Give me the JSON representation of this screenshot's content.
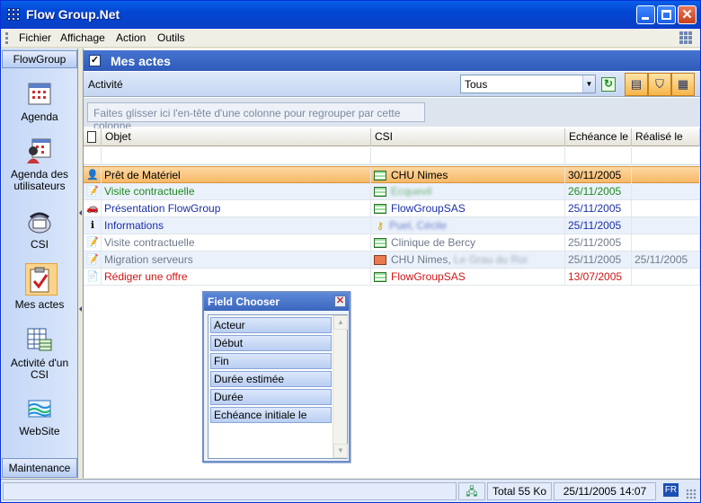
{
  "window": {
    "title": "Flow Group.Net"
  },
  "menu": [
    "Fichier",
    "Affichage",
    "Action",
    "Outils"
  ],
  "sidebar": {
    "header": "FlowGroup",
    "items": [
      {
        "label": "Agenda",
        "icon": "calendar-icon"
      },
      {
        "label": "Agenda des utilisateurs",
        "icon": "users-calendar-icon"
      },
      {
        "label": "CSI",
        "icon": "phone-icon"
      },
      {
        "label": "Mes actes",
        "icon": "clipboard-check-icon",
        "selected": true
      },
      {
        "label": "Activité d'un CSI",
        "icon": "spreadsheet-icon"
      },
      {
        "label": "WebSite",
        "icon": "globe-network-icon"
      }
    ],
    "footer": "Maintenance"
  },
  "section": {
    "title": "Mes actes"
  },
  "filter": {
    "label": "Activité",
    "value": "Tous"
  },
  "groupby_hint": "Faites glisser ici l'en-tête d'une colonne pour regrouper par cette colonne",
  "grid": {
    "columns": [
      "Objet",
      "CSI",
      "Echéance le",
      "Réalisé le"
    ],
    "rows": [
      {
        "icon": "person-icon",
        "objet": "Prêt de Matériel",
        "csi": "CHU Nimes",
        "echeance": "30/11/2005",
        "realise": "",
        "color": "#000000",
        "csi_color": "#000000",
        "selected": true
      },
      {
        "icon": "note-icon",
        "objet": "Visite contractuelle",
        "csi": "Ecquevil",
        "echeance": "26/11/2005",
        "realise": "",
        "color": "#1f8a1f",
        "csi_color": "#1f8a1f",
        "blur": true
      },
      {
        "icon": "car-icon",
        "objet": "Présentation FlowGroup",
        "csi": "FlowGroupSAS",
        "echeance": "25/11/2005",
        "realise": "",
        "color": "#1a2fa8",
        "csi_color": "#1a2fa8"
      },
      {
        "icon": "info-icon",
        "objet": "Informations",
        "csi": "Puel, Cécile",
        "echeance": "25/11/2005",
        "realise": "",
        "color": "#1a2fa8",
        "csi_color": "#1a2fa8",
        "blur": true,
        "csi_icon": "person-key-icon"
      },
      {
        "icon": "note-icon",
        "objet": "Visite contractuelle",
        "csi": "Clinique de Bercy",
        "echeance": "25/11/2005",
        "realise": "",
        "color": "#6f7a8a",
        "csi_color": "#6f7a8a"
      },
      {
        "icon": "note-icon",
        "objet": "Migration serveurs",
        "csi": "CHU Nimes,",
        "csi_extra": "Le Grau du Roi",
        "echeance": "25/11/2005",
        "realise": "25/11/2005",
        "color": "#6f7a8a",
        "csi_color": "#6f7a8a",
        "csi_icon": "house-icon"
      },
      {
        "icon": "doc-icon",
        "objet": "Rédiger une offre",
        "csi": "FlowGroupSAS",
        "echeance": "13/07/2005",
        "realise": "",
        "color": "#d01515",
        "csi_color": "#d01515"
      }
    ]
  },
  "field_chooser": {
    "title": "Field Chooser",
    "fields": [
      "Acteur",
      "Début",
      "Fin",
      "Durée estimée",
      "Durée",
      "Echéance initiale le"
    ]
  },
  "status": {
    "total": "Total 55 Ko",
    "datetime": "25/11/2005 14:07",
    "lang": "FR"
  }
}
